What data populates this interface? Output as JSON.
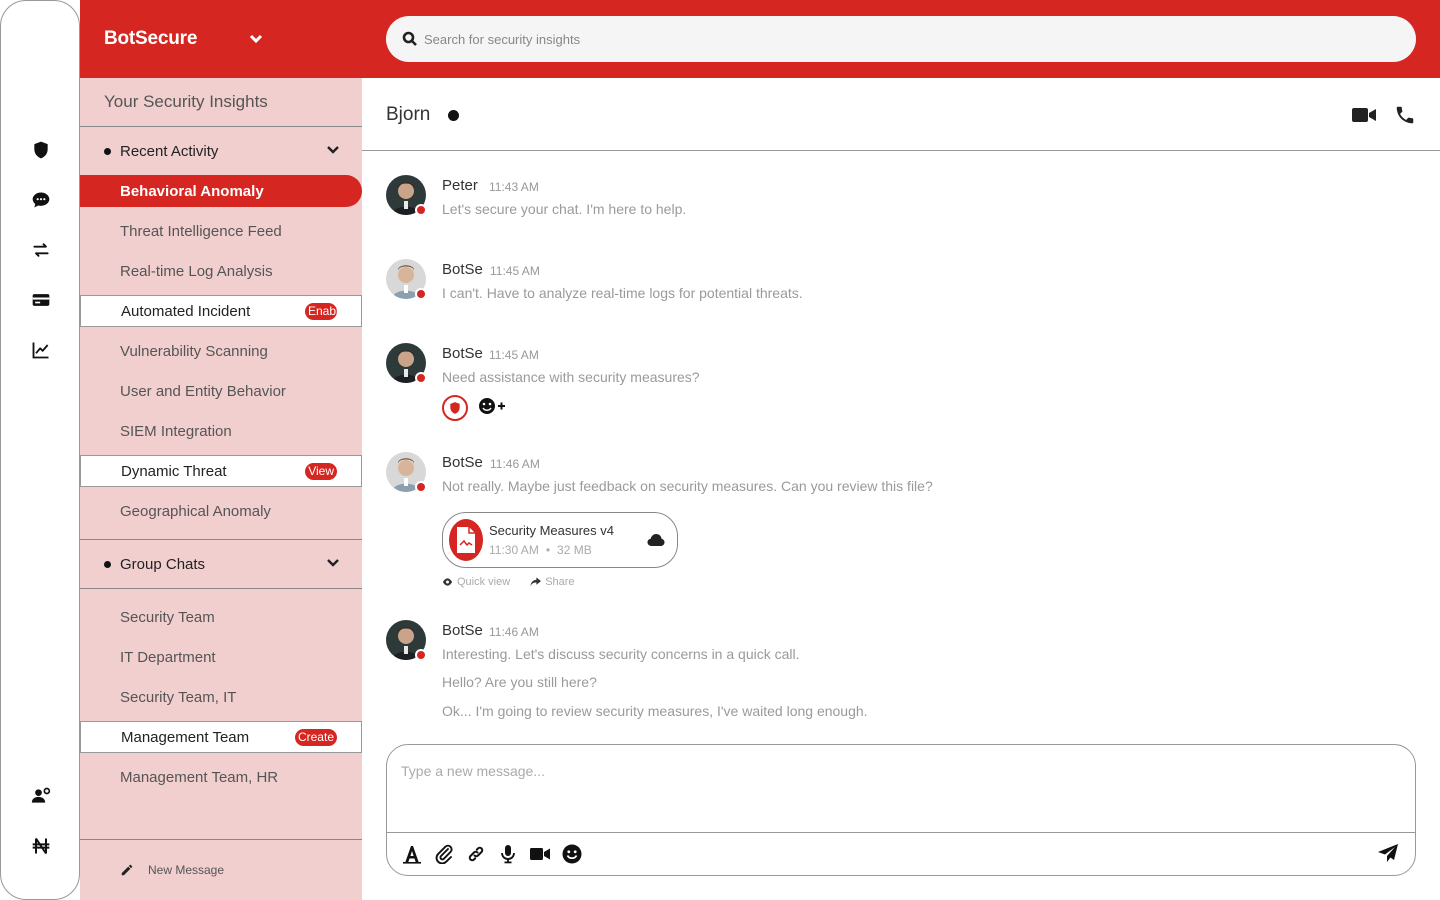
{
  "app": {
    "name": "BotSecure"
  },
  "search": {
    "placeholder": "Search for security insights"
  },
  "rail": {
    "top_icons": [
      "shield-icon",
      "chat-bubble-icon",
      "transfer-arrows-icon",
      "credit-card-icon",
      "line-chart-icon"
    ],
    "bottom_icons": [
      "user-settings-icon",
      "currency-icon"
    ]
  },
  "sidebar": {
    "section_title": "Your Security Insights",
    "groups": [
      {
        "label": "Recent Activity",
        "items": [
          {
            "label": "Behavioral Anomaly",
            "state": "active"
          },
          {
            "label": "Threat Intelligence Feed"
          },
          {
            "label": "Real-time Log Analysis"
          },
          {
            "label": "Automated Incident",
            "badge": "Enable",
            "state": "boxed"
          },
          {
            "label": "Vulnerability Scanning"
          },
          {
            "label": "User and Entity Behavior"
          },
          {
            "label": "SIEM Integration"
          },
          {
            "label": "Dynamic Threat",
            "badge": "View",
            "state": "boxed"
          },
          {
            "label": "Geographical Anomaly"
          }
        ]
      },
      {
        "label": "Group Chats",
        "items": [
          {
            "label": "Security Team"
          },
          {
            "label": "IT Department"
          },
          {
            "label": "Security Team, IT"
          },
          {
            "label": "Management Team",
            "badge": "Create",
            "state": "boxed"
          },
          {
            "label": "Management Team, HR"
          }
        ]
      }
    ],
    "new_message_label": "New Message"
  },
  "chat": {
    "contact": "Bjorn",
    "messages": [
      {
        "sender": "Peter",
        "time": "11:43 AM",
        "lines": [
          "Let's secure your chat. I'm here to help."
        ]
      },
      {
        "sender": "BotSe",
        "time": "11:45 AM",
        "lines": [
          "I can't. Have to analyze real-time logs for potential threats."
        ]
      },
      {
        "sender": "BotSe",
        "time": "11:45 AM",
        "lines": [
          "Need assistance with security measures?"
        ]
      },
      {
        "sender": "BotSe",
        "time": "11:46 AM",
        "lines": [
          "Not really. Maybe just feedback on security measures. Can you review this file?"
        ],
        "attachment": {
          "name": "Security Measures v4",
          "time": "11:30 AM",
          "size": "32 MB",
          "quick_view": "Quick view",
          "share": "Share"
        }
      },
      {
        "sender": "BotSe",
        "time": "11:46 AM",
        "lines": [
          "Interesting. Let's discuss security concerns in a quick call.",
          "Hello? Are you still here?",
          "Ok... I'm going to review security measures, I've waited long enough."
        ]
      }
    ]
  },
  "composer": {
    "placeholder": "Type a new message..."
  },
  "colors": {
    "accent": "#d52621",
    "sidebar_bg": "#f2cfcf",
    "muted_text": "#9a9a9a"
  }
}
